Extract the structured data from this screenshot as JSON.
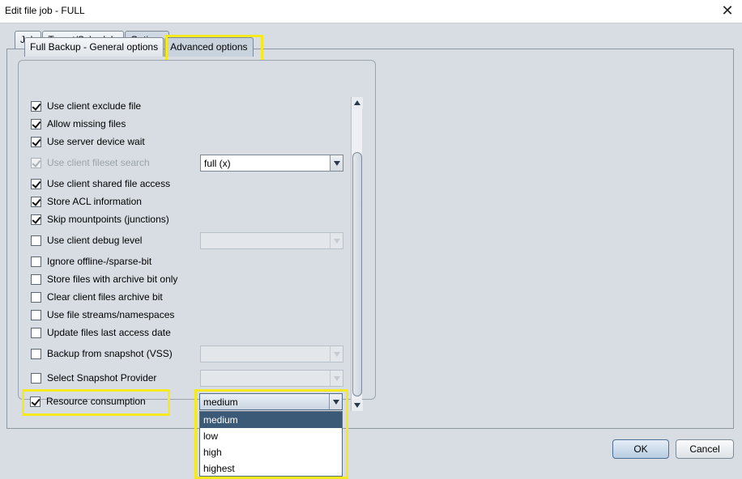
{
  "window": {
    "title": "Edit file job - FULL",
    "close_glyph": "✕"
  },
  "tabs": [
    "Job",
    "Target/Schedule",
    "Options"
  ],
  "subtabs": [
    "Full Backup - General options",
    "Advanced options"
  ],
  "options": {
    "use_client_exclude_file": "Use client exclude file",
    "allow_missing_files": "Allow missing files",
    "use_server_device_wait": "Use server device wait",
    "use_client_fileset_search": "Use client fileset search",
    "fileset_search_value": "full (x)",
    "use_client_shared_file_access": "Use client shared file access",
    "store_acl_information": "Store ACL information",
    "skip_mountpoints": "Skip mountpoints (junctions)",
    "use_client_debug_level": "Use client debug level",
    "ignore_offline_sparse": "Ignore offline-/sparse-bit",
    "store_archive_bit_only": "Store files with archive bit only",
    "clear_client_archive_bit": "Clear client files archive bit",
    "use_file_streams": "Use file streams/namespaces",
    "update_last_access_date": "Update files last access date",
    "backup_from_snapshot": "Backup from snapshot (VSS)",
    "select_snapshot_provider": "Select Snapshot Provider",
    "resource_consumption": "Resource consumption",
    "resource_consumption_value": "medium"
  },
  "resource_dropdown": [
    "medium",
    "low",
    "high",
    "highest"
  ],
  "buttons": {
    "ok": "OK",
    "cancel": "Cancel"
  },
  "colors": {
    "highlight": "#f5ea21",
    "selected": "#3b5a78"
  }
}
